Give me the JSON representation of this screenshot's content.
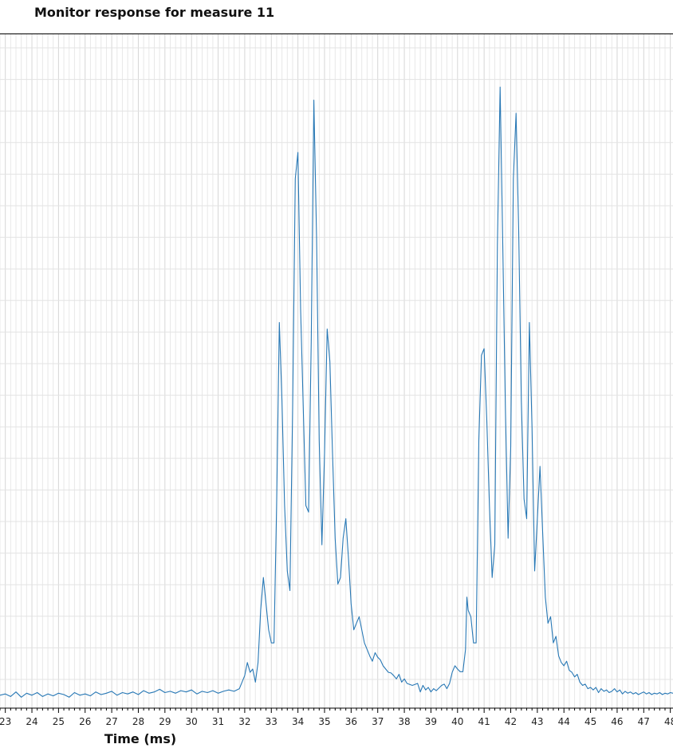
{
  "chart_data": {
    "type": "line",
    "title": "Monitor response for measure 11",
    "xlabel": "Time (ms)",
    "ylabel": "",
    "xlim": [
      22.8,
      48.1
    ],
    "ylim": [
      0,
      1
    ],
    "grid": true,
    "xticks": [
      "23",
      "24",
      "25",
      "26",
      "27",
      "28",
      "29",
      "30",
      "31",
      "32",
      "33",
      "34",
      "35",
      "36",
      "37",
      "38",
      "39",
      "40",
      "41",
      "42",
      "43",
      "44",
      "45",
      "46",
      "47",
      "48"
    ],
    "series": [
      {
        "color": "#2878b5",
        "points": [
          [
            22.8,
            0.01
          ],
          [
            23.0,
            0.012
          ],
          [
            23.2,
            0.008
          ],
          [
            23.4,
            0.015
          ],
          [
            23.6,
            0.007
          ],
          [
            23.8,
            0.013
          ],
          [
            24.0,
            0.01
          ],
          [
            24.2,
            0.014
          ],
          [
            24.4,
            0.008
          ],
          [
            24.6,
            0.012
          ],
          [
            24.8,
            0.009
          ],
          [
            25.0,
            0.013
          ],
          [
            25.2,
            0.011
          ],
          [
            25.4,
            0.007
          ],
          [
            25.6,
            0.014
          ],
          [
            25.8,
            0.01
          ],
          [
            26.0,
            0.012
          ],
          [
            26.2,
            0.009
          ],
          [
            26.4,
            0.015
          ],
          [
            26.6,
            0.011
          ],
          [
            26.8,
            0.013
          ],
          [
            27.0,
            0.016
          ],
          [
            27.2,
            0.01
          ],
          [
            27.4,
            0.014
          ],
          [
            27.6,
            0.012
          ],
          [
            27.8,
            0.015
          ],
          [
            28.0,
            0.011
          ],
          [
            28.2,
            0.017
          ],
          [
            28.4,
            0.013
          ],
          [
            28.6,
            0.015
          ],
          [
            28.8,
            0.019
          ],
          [
            29.0,
            0.014
          ],
          [
            29.2,
            0.016
          ],
          [
            29.4,
            0.013
          ],
          [
            29.6,
            0.017
          ],
          [
            29.8,
            0.015
          ],
          [
            30.0,
            0.018
          ],
          [
            30.2,
            0.012
          ],
          [
            30.4,
            0.016
          ],
          [
            30.6,
            0.014
          ],
          [
            30.8,
            0.017
          ],
          [
            31.0,
            0.013
          ],
          [
            31.2,
            0.016
          ],
          [
            31.4,
            0.018
          ],
          [
            31.6,
            0.016
          ],
          [
            31.8,
            0.02
          ],
          [
            32.0,
            0.04
          ],
          [
            32.1,
            0.06
          ],
          [
            32.2,
            0.045
          ],
          [
            32.3,
            0.05
          ],
          [
            32.4,
            0.03
          ],
          [
            32.5,
            0.06
          ],
          [
            32.6,
            0.14
          ],
          [
            32.7,
            0.19
          ],
          [
            32.8,
            0.15
          ],
          [
            32.9,
            0.11
          ],
          [
            33.0,
            0.09
          ],
          [
            33.1,
            0.09
          ],
          [
            33.2,
            0.3
          ],
          [
            33.3,
            0.58
          ],
          [
            33.4,
            0.46
          ],
          [
            33.5,
            0.3
          ],
          [
            33.6,
            0.2
          ],
          [
            33.7,
            0.17
          ],
          [
            33.8,
            0.45
          ],
          [
            33.9,
            0.8
          ],
          [
            34.0,
            0.84
          ],
          [
            34.1,
            0.6
          ],
          [
            34.3,
            0.3
          ],
          [
            34.4,
            0.29
          ],
          [
            34.5,
            0.55
          ],
          [
            34.6,
            0.92
          ],
          [
            34.7,
            0.71
          ],
          [
            34.8,
            0.4
          ],
          [
            34.9,
            0.24
          ],
          [
            35.0,
            0.38
          ],
          [
            35.1,
            0.57
          ],
          [
            35.2,
            0.52
          ],
          [
            35.3,
            0.38
          ],
          [
            35.4,
            0.25
          ],
          [
            35.5,
            0.18
          ],
          [
            35.6,
            0.19
          ],
          [
            35.7,
            0.25
          ],
          [
            35.8,
            0.28
          ],
          [
            35.9,
            0.22
          ],
          [
            36.0,
            0.15
          ],
          [
            36.1,
            0.11
          ],
          [
            36.2,
            0.12
          ],
          [
            36.3,
            0.13
          ],
          [
            36.4,
            0.11
          ],
          [
            36.5,
            0.09
          ],
          [
            36.6,
            0.08
          ],
          [
            36.7,
            0.07
          ],
          [
            36.8,
            0.062
          ],
          [
            36.9,
            0.075
          ],
          [
            37.0,
            0.068
          ],
          [
            37.1,
            0.064
          ],
          [
            37.2,
            0.055
          ],
          [
            37.3,
            0.05
          ],
          [
            37.4,
            0.045
          ],
          [
            37.5,
            0.044
          ],
          [
            37.6,
            0.04
          ],
          [
            37.7,
            0.035
          ],
          [
            37.8,
            0.042
          ],
          [
            37.9,
            0.03
          ],
          [
            38.0,
            0.035
          ],
          [
            38.1,
            0.028
          ],
          [
            38.3,
            0.025
          ],
          [
            38.5,
            0.028
          ],
          [
            38.6,
            0.015
          ],
          [
            38.7,
            0.025
          ],
          [
            38.8,
            0.018
          ],
          [
            38.9,
            0.022
          ],
          [
            39.0,
            0.015
          ],
          [
            39.1,
            0.02
          ],
          [
            39.2,
            0.017
          ],
          [
            39.4,
            0.025
          ],
          [
            39.5,
            0.027
          ],
          [
            39.6,
            0.02
          ],
          [
            39.7,
            0.028
          ],
          [
            39.8,
            0.045
          ],
          [
            39.9,
            0.055
          ],
          [
            40.0,
            0.05
          ],
          [
            40.1,
            0.046
          ],
          [
            40.2,
            0.046
          ],
          [
            40.3,
            0.08
          ],
          [
            40.35,
            0.16
          ],
          [
            40.4,
            0.14
          ],
          [
            40.5,
            0.13
          ],
          [
            40.6,
            0.09
          ],
          [
            40.7,
            0.09
          ],
          [
            40.8,
            0.4
          ],
          [
            40.9,
            0.53
          ],
          [
            41.0,
            0.54
          ],
          [
            41.1,
            0.43
          ],
          [
            41.2,
            0.3
          ],
          [
            41.3,
            0.19
          ],
          [
            41.4,
            0.24
          ],
          [
            41.5,
            0.7
          ],
          [
            41.6,
            0.94
          ],
          [
            41.7,
            0.7
          ],
          [
            41.8,
            0.45
          ],
          [
            41.9,
            0.25
          ],
          [
            42.0,
            0.39
          ],
          [
            42.1,
            0.8
          ],
          [
            42.2,
            0.9
          ],
          [
            42.3,
            0.72
          ],
          [
            42.4,
            0.46
          ],
          [
            42.5,
            0.31
          ],
          [
            42.6,
            0.28
          ],
          [
            42.7,
            0.58
          ],
          [
            42.8,
            0.42
          ],
          [
            42.9,
            0.2
          ],
          [
            43.0,
            0.28
          ],
          [
            43.1,
            0.36
          ],
          [
            43.2,
            0.26
          ],
          [
            43.3,
            0.16
          ],
          [
            43.4,
            0.12
          ],
          [
            43.5,
            0.13
          ],
          [
            43.6,
            0.09
          ],
          [
            43.7,
            0.1
          ],
          [
            43.8,
            0.07
          ],
          [
            43.9,
            0.06
          ],
          [
            44.0,
            0.055
          ],
          [
            44.1,
            0.062
          ],
          [
            44.2,
            0.048
          ],
          [
            44.3,
            0.045
          ],
          [
            44.4,
            0.038
          ],
          [
            44.5,
            0.042
          ],
          [
            44.6,
            0.03
          ],
          [
            44.7,
            0.025
          ],
          [
            44.8,
            0.027
          ],
          [
            44.9,
            0.02
          ],
          [
            45.0,
            0.022
          ],
          [
            45.1,
            0.018
          ],
          [
            45.2,
            0.022
          ],
          [
            45.3,
            0.014
          ],
          [
            45.4,
            0.02
          ],
          [
            45.5,
            0.016
          ],
          [
            45.6,
            0.018
          ],
          [
            45.7,
            0.014
          ],
          [
            45.8,
            0.016
          ],
          [
            45.9,
            0.02
          ],
          [
            46.0,
            0.015
          ],
          [
            46.1,
            0.018
          ],
          [
            46.2,
            0.012
          ],
          [
            46.3,
            0.016
          ],
          [
            46.4,
            0.013
          ],
          [
            46.5,
            0.015
          ],
          [
            46.6,
            0.012
          ],
          [
            46.7,
            0.014
          ],
          [
            46.8,
            0.011
          ],
          [
            46.9,
            0.013
          ],
          [
            47.0,
            0.015
          ],
          [
            47.1,
            0.012
          ],
          [
            47.2,
            0.014
          ],
          [
            47.3,
            0.011
          ],
          [
            47.4,
            0.013
          ],
          [
            47.5,
            0.012
          ],
          [
            47.6,
            0.014
          ],
          [
            47.7,
            0.011
          ],
          [
            47.8,
            0.013
          ],
          [
            47.9,
            0.012
          ],
          [
            48.0,
            0.014
          ],
          [
            48.1,
            0.013
          ]
        ]
      }
    ]
  }
}
